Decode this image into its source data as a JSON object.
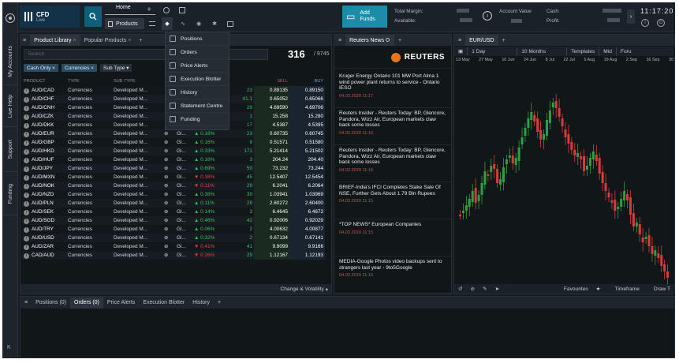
{
  "sidebar": {
    "tabs": [
      "My Accounts",
      "Live Help",
      "Support",
      "Funding"
    ],
    "collapse": "K"
  },
  "topbar": {
    "logo_title": "CFD",
    "logo_sub": "Live",
    "home_tab": "Home",
    "products_label": "Products",
    "add_funds": "Add Funds",
    "total_margin_label": "Total Margin:",
    "available_label": "Available:",
    "account_value_label": "Account Value",
    "cash_label": "Cash:",
    "profit_label": "Profit:",
    "time": "11:17:20"
  },
  "dropdown": {
    "items": [
      "Positions",
      "Orders",
      "Price Alerts",
      "Execution Blotter",
      "History",
      "Statement Centre",
      "Funding"
    ]
  },
  "library": {
    "tabs": [
      "Product Library",
      "Popular Products"
    ],
    "search_placeholder": "Search",
    "count": "316",
    "total": "/ 9745",
    "filters": [
      "Cash Only",
      "Currencies",
      "Sub Type"
    ],
    "headers": [
      "PRODUCT",
      "TYPE",
      "SUB TYPE",
      "",
      "",
      "",
      "SELL",
      "BUY"
    ],
    "rows": [
      {
        "p": "AUD/CAD",
        "t": "Currencies",
        "s": "Developed M...",
        "c": "",
        "chg": "",
        "sp": "23",
        "sell": "0.89135",
        "buy": "0.89150",
        "d": ""
      },
      {
        "p": "AUD/CHF",
        "t": "Currencies",
        "s": "Developed M...",
        "c": "",
        "chg": "",
        "sp": "41.1",
        "sell": "0.65052",
        "buy": "0.65066",
        "d": ""
      },
      {
        "p": "AUD/CNH",
        "t": "Currencies",
        "s": "Developed M...",
        "c": "",
        "chg": "",
        "sp": "29",
        "sell": "4.69590",
        "buy": "4.69706",
        "d": ""
      },
      {
        "p": "AUD/CZK",
        "t": "Currencies",
        "s": "Developed M...",
        "c": "",
        "chg": "",
        "sp": "1",
        "sell": "15.258",
        "buy": "15.280",
        "d": ""
      },
      {
        "p": "AUD/DKK",
        "t": "Currencies",
        "s": "Developed M...",
        "c": "",
        "chg": "",
        "sp": "17",
        "sell": "4.5387",
        "buy": "4.5395",
        "d": ""
      },
      {
        "p": "AUD/EUR",
        "t": "Currencies",
        "s": "Developed M...",
        "c": "Gl...",
        "chg": "0.16%",
        "sp": "23",
        "sell": "0.60735",
        "buy": "0.60745",
        "d": "pos"
      },
      {
        "p": "AUD/GBP",
        "t": "Currencies",
        "s": "Developed M...",
        "c": "Gl...",
        "chg": "0.16%",
        "sp": "9",
        "sell": "0.51571",
        "buy": "0.51580",
        "d": "pos"
      },
      {
        "p": "AUD/HKD",
        "t": "Currencies",
        "s": "Developed M...",
        "c": "Gl...",
        "chg": "0.33%",
        "sp": "171",
        "sell": "5.21414",
        "buy": "5.21502",
        "d": "pos"
      },
      {
        "p": "AUD/HUF",
        "t": "Currencies",
        "s": "Developed M...",
        "c": "Gl...",
        "chg": "0.16%",
        "sp": "3",
        "sell": "204.24",
        "buy": "204.40",
        "d": "pos"
      },
      {
        "p": "AUD/JPY",
        "t": "Currencies",
        "s": "Developed M...",
        "c": "Gl...",
        "chg": "0.69%",
        "sp": "50",
        "sell": "73.232",
        "buy": "73.244",
        "d": "pos"
      },
      {
        "p": "AUD/MXN",
        "t": "Currencies",
        "s": "Developed M...",
        "c": "Gl...",
        "chg": "0.38%",
        "sp": "45",
        "sell": "12.5407",
        "buy": "12.5454",
        "d": "neg"
      },
      {
        "p": "AUD/NOK",
        "t": "Currencies",
        "s": "Developed M...",
        "c": "Gl...",
        "chg": "0.11%",
        "sp": "29",
        "sell": "6.2041",
        "buy": "6.2064",
        "d": "neg"
      },
      {
        "p": "AUD/NZD",
        "t": "Currencies",
        "s": "Developed M...",
        "c": "Gl...",
        "chg": "0.38%",
        "sp": "39",
        "sell": "1.03941",
        "buy": "1.03969",
        "d": "pos"
      },
      {
        "p": "AUD/PLN",
        "t": "Currencies",
        "s": "Developed M...",
        "c": "Gl...",
        "chg": "0.11%",
        "sp": "29",
        "sell": "2.60272",
        "buy": "2.60400",
        "d": "pos"
      },
      {
        "p": "AUD/SEK",
        "t": "Currencies",
        "s": "Developed M...",
        "c": "Gl...",
        "chg": "0.14%",
        "sp": "3",
        "sell": "6.4645",
        "buy": "6.4672",
        "d": "pos"
      },
      {
        "p": "AUD/SGD",
        "t": "Currencies",
        "s": "Developed M...",
        "c": "Gl...",
        "chg": "0.46%",
        "sp": "42",
        "sell": "0.92006",
        "buy": "0.92029",
        "d": "pos"
      },
      {
        "p": "AUD/TRY",
        "t": "Currencies",
        "s": "Developed M...",
        "c": "Gl...",
        "chg": "0.06%",
        "sp": "2",
        "sell": "4.00632",
        "buy": "4.00877",
        "d": "pos"
      },
      {
        "p": "AUD/USD",
        "t": "Currencies",
        "s": "Developed M...",
        "c": "Gl...",
        "chg": "0.32%",
        "sp": "2",
        "sell": "0.67134",
        "buy": "0.67141",
        "d": "pos"
      },
      {
        "p": "AUD/ZAR",
        "t": "Currencies",
        "s": "Developed M...",
        "c": "Gl...",
        "chg": "0.41%",
        "sp": "41",
        "sell": "9.9099",
        "buy": "9.9166",
        "d": "neg"
      },
      {
        "p": "CAD/AUD",
        "t": "Currencies",
        "s": "Developed M...",
        "c": "Gl...",
        "chg": "0.26%",
        "sp": "29",
        "sell": "1.12167",
        "buy": "1.12193",
        "d": "neg"
      }
    ],
    "footer": "Change & Volatility"
  },
  "news": {
    "tab": "Reuters News",
    "brand": "REUTERS",
    "items": [
      {
        "title": "Kruger Energy Ontario 101 MW Port Alma 1 wind power plant returns to service - Ontario IESO",
        "time": "04.02.2020 11:17"
      },
      {
        "title": "Reuters Insider - Reuters Today: BP, Glencore, Pandora, Wizz Air, European markets claw back some losses",
        "time": "04.02.2020 11:16"
      },
      {
        "title": "Reuters Insider - Reuters Today: BP, Glencore, Pandora, Wizz Air, European markets claw back some losses",
        "time": "04.02.2020 11:16"
      },
      {
        "title": "BRIEF-India's IFCI Completes Stake Sale Of NSE, Further Gets About 1.79 Bln Rupees",
        "time": "04.02.2020 11:15"
      },
      {
        "title": "*TOP NEWS* European Companies",
        "time": "04.02.2020 11:15"
      },
      {
        "title": "MEDIA-Google Photos video backups sent to strangers last year - 9to5Google",
        "time": "04.02.2020 11:15"
      }
    ]
  },
  "chart": {
    "symbol": "EUR/USD",
    "interval": "1 Day",
    "range": "10 Months",
    "templates": "Templates",
    "mid": "Mid",
    "extra": "Foru",
    "dates": [
      "13 May",
      "27 May",
      "10 Jun",
      "24 Jun",
      "8 Jul",
      "22 Jul",
      "5 Aug",
      "19 Aug",
      "2 Sep",
      "16 Sep",
      "30"
    ],
    "footer": [
      "Favourites",
      "Timeframe",
      "Draw T"
    ],
    "colors": {
      "up": "#2ea043",
      "down": "#d93a3a"
    }
  },
  "bottom": {
    "tabs": [
      "Positions (0)",
      "Orders (0)",
      "Price Alerts",
      "Execution Blotter",
      "History"
    ]
  }
}
